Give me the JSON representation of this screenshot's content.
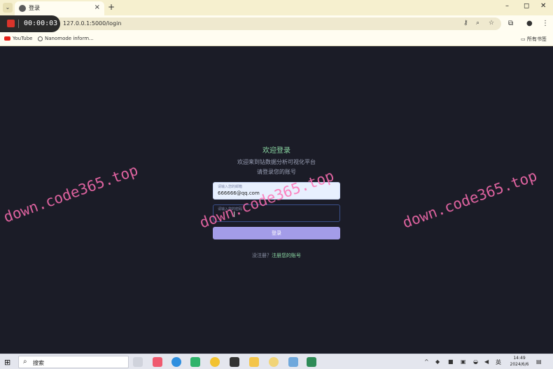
{
  "browser": {
    "tab_title": "登录",
    "tab_close": "×",
    "new_tab": "+",
    "url": "127.0.0.1:5000/login",
    "window_controls": {
      "minimize": "–",
      "maximize": "◻",
      "close": "✕"
    }
  },
  "recording": {
    "time": "00:00:03"
  },
  "bookmarks": {
    "items": [
      "YouTube",
      "Nanomode inform..."
    ],
    "all_bookmarks": "所有书签"
  },
  "login": {
    "title": "欢迎登录",
    "subtitle": "欢迎来到钻数据分析可视化平台",
    "hint": "请登录您的账号",
    "username_label": "请输入您的邮箱",
    "username_value": "666666@qq.com",
    "password_label": "请输入您的密码",
    "password_value": "",
    "submit_label": "登录",
    "register_prompt": "没注册？",
    "register_link": "注册您的账号"
  },
  "watermark": {
    "text": "down.code365.top"
  },
  "taskbar": {
    "search_placeholder": "搜索",
    "clock_time": "14:49",
    "clock_date": "2024/6/6",
    "ime": "英"
  },
  "colors": {
    "page_bg": "#1b1c27",
    "accent_green": "#8cd9a4",
    "button": "#a39ce8",
    "browser_chrome": "#f6f0cf",
    "record": "#d9342b"
  }
}
